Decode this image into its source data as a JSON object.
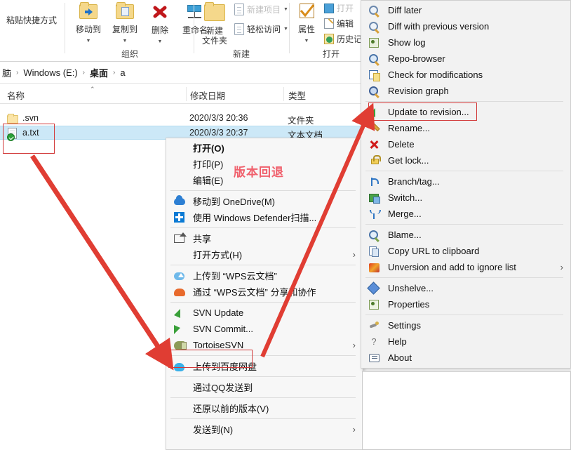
{
  "ribbon": {
    "buttons": [
      {
        "label": "粘贴快捷方式",
        "icon": "paste-shortcut-icon"
      },
      {
        "label": "移动到",
        "icon": "move-to-icon"
      },
      {
        "label": "复制到",
        "icon": "copy-to-icon"
      },
      {
        "label": "删除",
        "icon": "delete-icon"
      },
      {
        "label": "重命名",
        "icon": "rename-icon"
      },
      {
        "label": "新建\n文件夹",
        "icon": "new-folder-icon"
      },
      {
        "label": "轻松访问",
        "icon": "easy-access-icon"
      },
      {
        "label": "属性",
        "icon": "properties-icon"
      },
      {
        "label": "打开",
        "icon": "open-icon"
      },
      {
        "label": "编辑",
        "icon": "edit-icon"
      },
      {
        "label": "历史记",
        "icon": "history-icon"
      }
    ],
    "new_folder_line1": "新建",
    "new_folder_line2": "文件夹",
    "easy_access": "轻松访问",
    "properties": "属性",
    "open_small": "打开",
    "edit_small": "编辑",
    "history_small": "历史记",
    "move_to": "移动到",
    "copy_to": "复制到",
    "delete": "删除",
    "rename": "重命名",
    "paste_shortcut": "粘贴快捷方式",
    "groups": [
      {
        "caption": "组织"
      },
      {
        "caption": "新建"
      },
      {
        "caption": "打开"
      }
    ],
    "group_organize": "组织",
    "group_new": "新建",
    "group_open": "打开"
  },
  "address_bar": {
    "crumbs": [
      "电脑",
      "Windows (E:)",
      "桌面",
      "a"
    ],
    "c0": "脑",
    "c1": "Windows (E:)",
    "c2": "桌面",
    "c3": "a",
    "separator": "›"
  },
  "columns": {
    "name": "名称",
    "date_modified": "修改日期",
    "type": "类型",
    "sort_caret": "⌃"
  },
  "files": [
    {
      "name": ".svn",
      "date": "2020/3/3 20:36",
      "type": "文件夹",
      "icon": "folder-icon",
      "selected": false
    },
    {
      "name": "a.txt",
      "date": "2020/3/3 20:37",
      "type": "文本文档",
      "icon": "text-document-icon",
      "selected": true
    }
  ],
  "file0": {
    "name": ".svn",
    "date": "2020/3/3 20:36",
    "type": "文件夹"
  },
  "file1": {
    "name": "a.txt",
    "date": "2020/3/3 20:37",
    "type": "文本文档"
  },
  "context_menu": {
    "items": [
      {
        "label": "打开(O)",
        "bold": true,
        "icon": null,
        "submenu": false
      },
      {
        "label": "打印(P)",
        "bold": false,
        "icon": null,
        "submenu": false
      },
      {
        "label": "编辑(E)",
        "bold": false,
        "icon": null,
        "submenu": false
      },
      {
        "label": "移动到 OneDrive(M)",
        "bold": false,
        "icon": "onedrive-icon",
        "submenu": false
      },
      {
        "label": "使用 Windows Defender扫描...",
        "bold": false,
        "icon": "windows-defender-icon",
        "submenu": false
      },
      {
        "label": "共享",
        "bold": false,
        "icon": "share-icon",
        "submenu": false
      },
      {
        "label": "打开方式(H)",
        "bold": false,
        "icon": null,
        "submenu": true
      },
      {
        "label": "上传到 “WPS云文档”",
        "bold": false,
        "icon": "wps-upload-icon",
        "submenu": false
      },
      {
        "label": "通过 “WPS云文档” 分享和协作",
        "bold": false,
        "icon": "wps-share-icon",
        "submenu": false
      },
      {
        "label": "SVN Update",
        "bold": false,
        "icon": "svn-update-icon",
        "submenu": false
      },
      {
        "label": "SVN Commit...",
        "bold": false,
        "icon": "svn-commit-icon",
        "submenu": false
      },
      {
        "label": "TortoiseSVN",
        "bold": false,
        "icon": "tortoisesvn-icon",
        "submenu": true,
        "highlighted": true
      },
      {
        "label": "上传到百度网盘",
        "bold": false,
        "icon": "baidu-netdisk-icon",
        "submenu": false
      },
      {
        "label": "通过QQ发送到",
        "bold": false,
        "icon": null,
        "submenu": false
      },
      {
        "label": "还原以前的版本(V)",
        "bold": false,
        "icon": null,
        "submenu": false
      },
      {
        "label": "发送到(N)",
        "bold": false,
        "icon": null,
        "submenu": true
      }
    ],
    "m0": "打开(O)",
    "m1": "打印(P)",
    "m2": "编辑(E)",
    "m3": "移动到 OneDrive(M)",
    "m4": "使用 Windows Defender扫描...",
    "m5": "共享",
    "m6": "打开方式(H)",
    "m7": "上传到 “WPS云文档”",
    "m8": "通过 “WPS云文档” 分享和协作",
    "m9": "SVN Update",
    "m10": "SVN Commit...",
    "m11": "TortoiseSVN",
    "m12": "上传到百度网盘",
    "m13": "通过QQ发送到",
    "m14": "还原以前的版本(V)",
    "m15": "发送到(N)",
    "arrow": "›"
  },
  "submenu": {
    "items": [
      {
        "label": "Diff later",
        "icon": "diff-later-icon",
        "submenu": false
      },
      {
        "label": "Diff with previous version",
        "icon": "diff-previous-icon",
        "submenu": false
      },
      {
        "label": "Show log",
        "icon": "show-log-icon",
        "submenu": false
      },
      {
        "label": "Repo-browser",
        "icon": "repo-browser-icon",
        "submenu": false
      },
      {
        "label": "Check for modifications",
        "icon": "check-modifications-icon",
        "submenu": false
      },
      {
        "label": "Revision graph",
        "icon": "revision-graph-icon",
        "submenu": false
      },
      {
        "label": "Update to revision...",
        "icon": "update-revision-icon",
        "submenu": false,
        "highlighted": true
      },
      {
        "label": "Rename...",
        "icon": "rename-pencil-icon",
        "submenu": false
      },
      {
        "label": "Delete",
        "icon": "delete-x-icon",
        "submenu": false
      },
      {
        "label": "Get lock...",
        "icon": "lock-icon",
        "submenu": false
      },
      {
        "label": "Branch/tag...",
        "icon": "branch-tag-icon",
        "submenu": false
      },
      {
        "label": "Switch...",
        "icon": "switch-icon",
        "submenu": false
      },
      {
        "label": "Merge...",
        "icon": "merge-icon",
        "submenu": false
      },
      {
        "label": "Blame...",
        "icon": "blame-icon",
        "submenu": false
      },
      {
        "label": "Copy URL to clipboard",
        "icon": "copy-url-icon",
        "submenu": false
      },
      {
        "label": "Unversion and add to ignore list",
        "icon": "unversion-icon",
        "submenu": true
      },
      {
        "label": "Unshelve...",
        "icon": "unshelve-icon",
        "submenu": false
      },
      {
        "label": "Properties",
        "icon": "properties-svn-icon",
        "submenu": false
      },
      {
        "label": "Settings",
        "icon": "settings-icon",
        "submenu": false
      },
      {
        "label": "Help",
        "icon": "help-icon",
        "submenu": false
      },
      {
        "label": "About",
        "icon": "about-icon",
        "submenu": false
      }
    ],
    "s0": "Diff later",
    "s1": "Diff with previous version",
    "s2": "Show log",
    "s3": "Repo-browser",
    "s4": "Check for modifications",
    "s5": "Revision graph",
    "s6": "Update to revision...",
    "s7": "Rename...",
    "s8": "Delete",
    "s9": "Get lock...",
    "s10": "Branch/tag...",
    "s11": "Switch...",
    "s12": "Merge...",
    "s13": "Blame...",
    "s14": "Copy URL to clipboard",
    "s15": "Unversion and add to ignore list",
    "s16": "Unshelve...",
    "s17": "Properties",
    "s18": "Settings",
    "s19": "Help",
    "s20": "About",
    "arrow": "›"
  },
  "annotation": {
    "text": "版本回退",
    "color": "#f0606c",
    "box_color": "#d23a3a",
    "arrow_color": "#e03d33"
  }
}
